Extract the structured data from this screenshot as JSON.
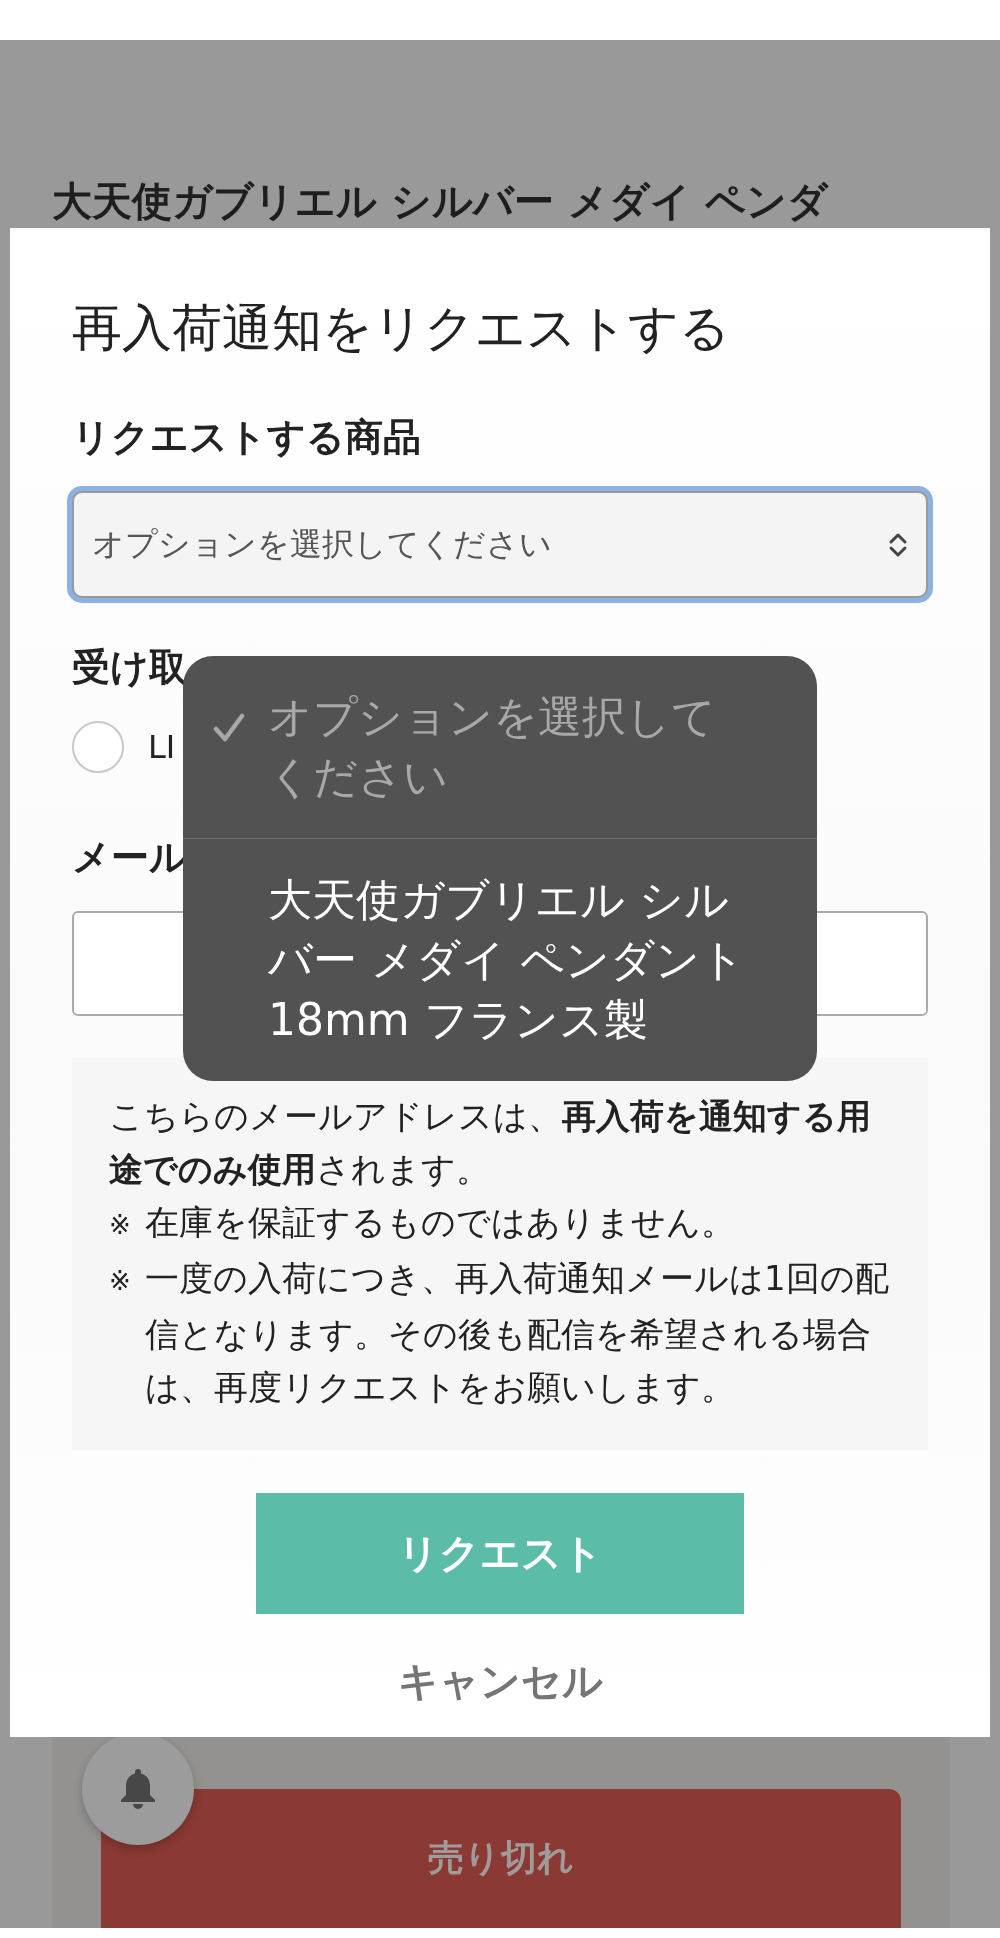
{
  "background_page": {
    "product_title": "大天使ガブリエル シルバー メダイ ペンダ",
    "sold_out_button": "売り切れ"
  },
  "modal": {
    "title": "再入荷通知をリクエストする",
    "product_label": "リクエストする商品",
    "product_select": {
      "value": "オプションを選択してください"
    },
    "delivery_label": "受け取",
    "delivery_options": [
      {
        "label": "LI",
        "selected": false
      }
    ],
    "email_label": "メール",
    "notice": [
      {
        "kind": "text",
        "text": "こちらのメールアドレスは、**再入荷を通知する用途でのみ使用**されます。"
      },
      {
        "kind": "note",
        "mark": "※",
        "text": "在庫を保証するものではありません。"
      },
      {
        "kind": "note",
        "mark": "※",
        "text": "一度の入荷につき、再入荷通知メールは1回の配信となります。その後も配信を希望される場合は、再度リクエストをお願いします。"
      }
    ],
    "request_button": "リクエスト",
    "cancel_button": "キャンセル"
  },
  "dropdown": {
    "options": [
      {
        "label": "オプションを選択してください",
        "selected": true,
        "disabled": true
      },
      {
        "label": "大天使ガブリエル シルバー メダイ ペンダント 18mm フランス製",
        "selected": false,
        "disabled": false
      }
    ]
  }
}
